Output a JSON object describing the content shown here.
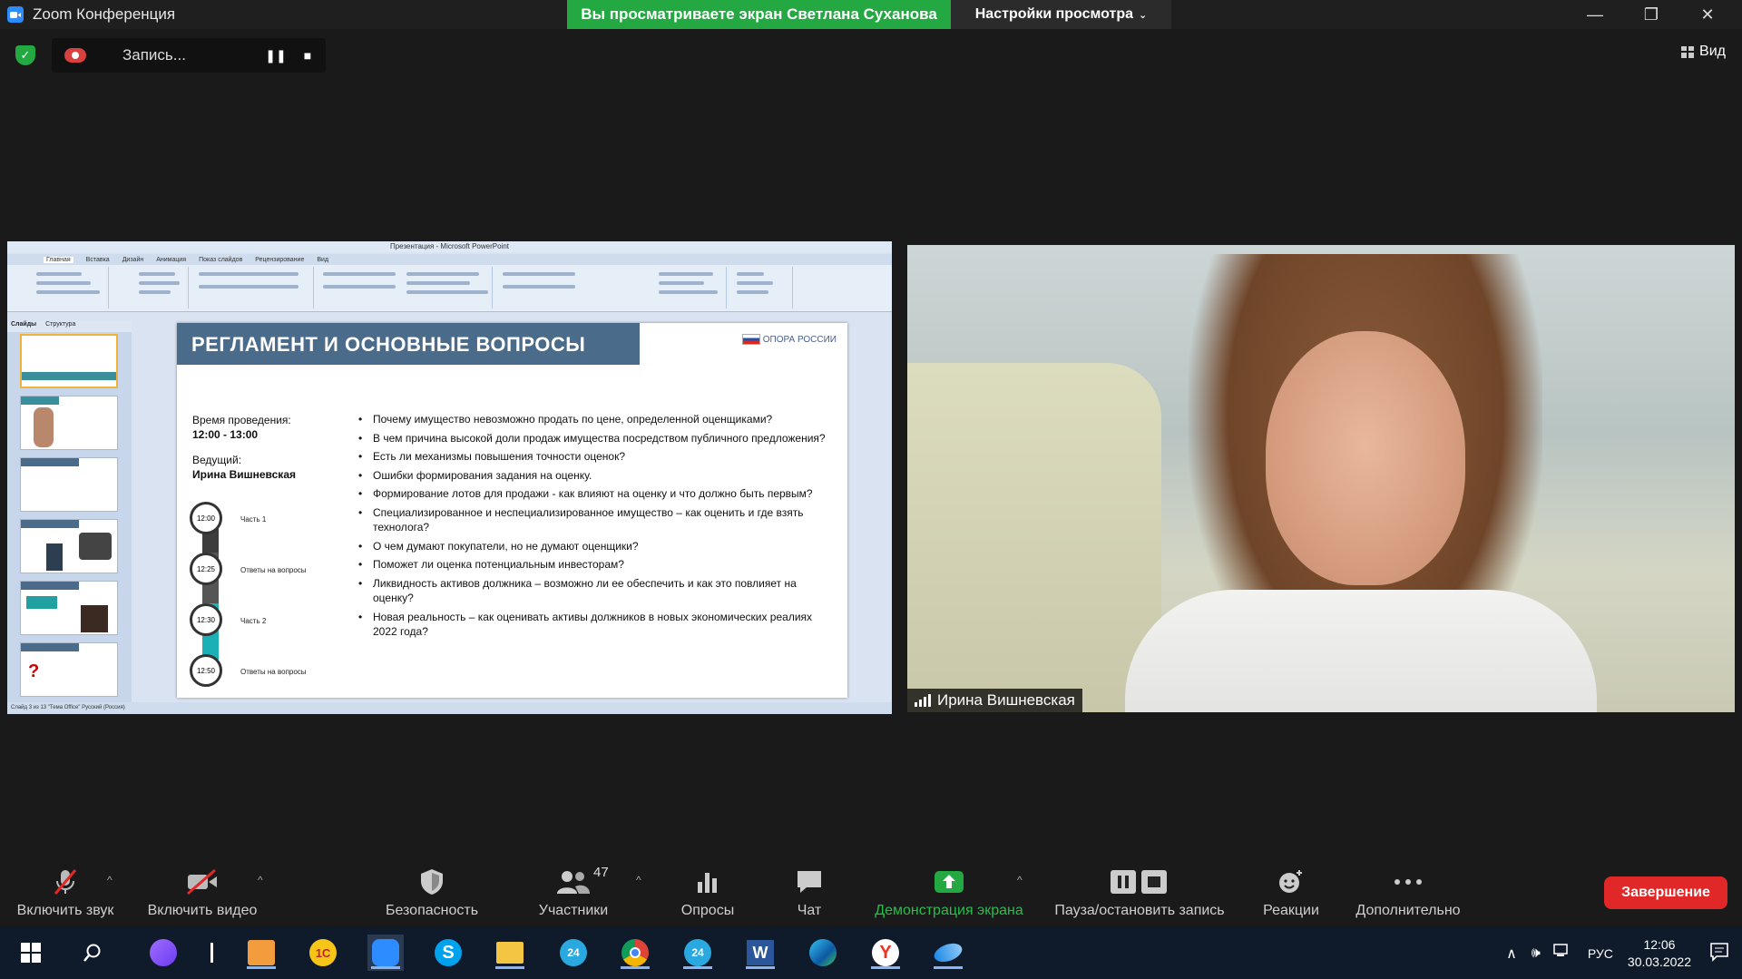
{
  "window": {
    "title": "Zoom Конференция",
    "share_banner": "Вы просматриваете экран Светлана Суханова",
    "view_settings": "Настройки просмотра",
    "minimize": "—",
    "restore": "❐",
    "close": "✕"
  },
  "recording": {
    "label": "Запись...",
    "view_label": "Вид"
  },
  "ppt": {
    "window_title": "Презентация - Microsoft PowerPoint",
    "tabs": [
      "Главная",
      "Вставка",
      "Дизайн",
      "Анимация",
      "Показ слайдов",
      "Рецензирование",
      "Вид"
    ],
    "panel_tabs": [
      "Слайды",
      "Структура"
    ],
    "status": "Слайд 3 из 13   \"Тема Office\"   Русский (Россия)"
  },
  "slide": {
    "title": "РЕГЛАМЕНТ И ОСНОВНЫЕ ВОПРОСЫ",
    "logo_text": "ОПОРА РОССИИ",
    "time_label": "Время проведения:",
    "time_value": "12:00 - 13:00",
    "host_label": "Ведущий:",
    "host_value": "Ирина Вишневская",
    "timeline": [
      {
        "time": "12:00",
        "label": "Часть 1"
      },
      {
        "time": "12:25",
        "label": "Ответы на вопросы"
      },
      {
        "time": "12:30",
        "label": "Часть 2"
      },
      {
        "time": "12:50",
        "label": "Ответы на вопросы"
      }
    ],
    "bullets": [
      "Почему имущество невозможно продать по цене, определенной оценщиками?",
      "В чем причина высокой доли продаж имущества посредством публичного предложения?",
      "Есть ли механизмы повышения точности оценок?",
      "Ошибки формирования задания на оценку.",
      "Формирование лотов для продажи  -  как влияют на оценку и что должно быть первым?",
      "Специализированное и неспециализированное имущество – как оценить и где взять технолога?",
      "О чем думают покупатели, но не думают оценщики?",
      "Поможет ли оценка потенциальным инвесторам?",
      "Ликвидность активов должника – возможно ли ее обеспечить и как это повлияет на оценку?",
      "Новая реальность – как оценивать активы должников в новых экономических реалиях 2022 года?"
    ]
  },
  "video": {
    "participant_name": "Ирина Вишневская"
  },
  "toolbar": {
    "audio": "Включить звук",
    "video": "Включить видео",
    "security": "Безопасность",
    "participants": "Участники",
    "participants_count": "47",
    "polls": "Опросы",
    "chat": "Чат",
    "share": "Демонстрация экрана",
    "pause_record": "Пауза/остановить запись",
    "reactions": "Реакции",
    "more": "Дополнительно",
    "end": "Завершение"
  },
  "taskbar": {
    "lang": "РУС",
    "time": "12:06",
    "date": "30.03.2022"
  },
  "colors": {
    "zoom_green": "#23a842",
    "end_red": "#e02828",
    "slide_header": "#4a6b8a"
  }
}
